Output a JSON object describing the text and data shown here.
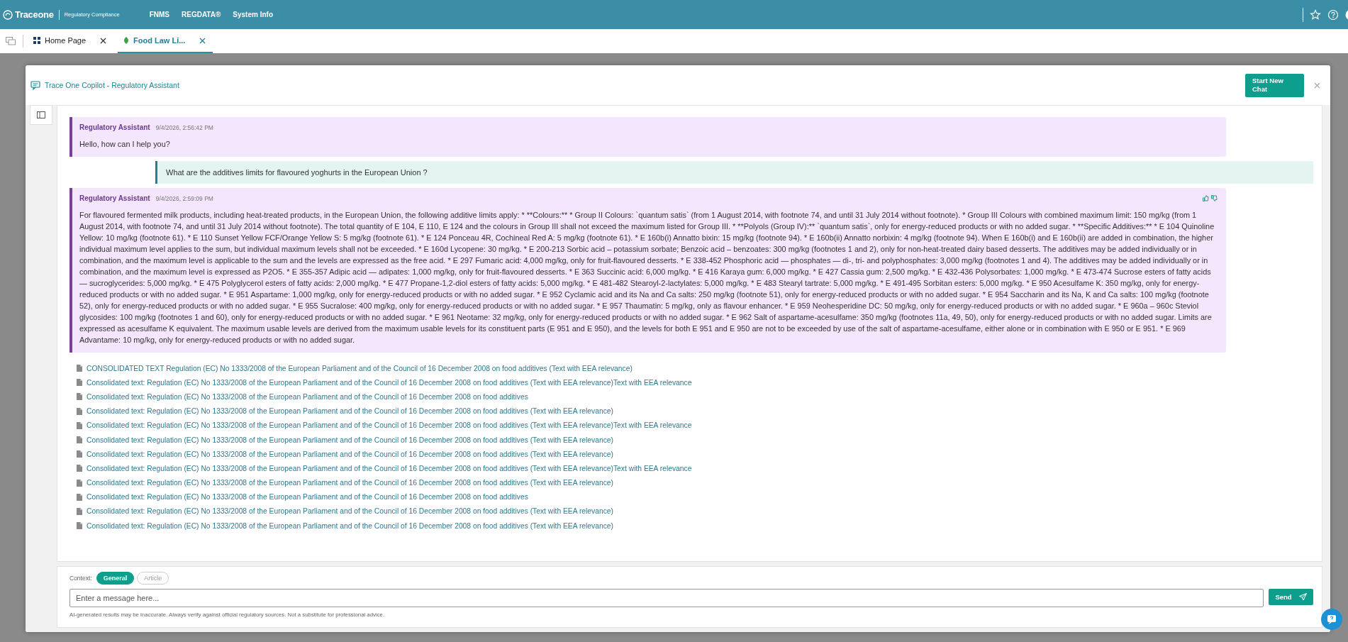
{
  "app": {
    "brand": "Traceone",
    "subtitle": "Regulatory Compliance",
    "nav": [
      {
        "label": "FNMS"
      },
      {
        "label": "REGDATA®"
      },
      {
        "label": "System Info"
      }
    ]
  },
  "tabs": [
    {
      "label": "Home Page",
      "selected": false
    },
    {
      "label": "Food Law Li...",
      "selected": true
    }
  ],
  "dialog": {
    "title": "Trace One Copilot - Regulatory Assistant",
    "new_chat_button": "Start New Chat"
  },
  "messages": [
    {
      "kind": "assistant",
      "author": "Regulatory Assistant",
      "time": "9/4/2026, 2:56:42 PM",
      "text": "Hello, how can I help you?",
      "feedback": false
    },
    {
      "kind": "user",
      "text": "What are the additives limits for flavoured yoghurts in the European Union ?"
    },
    {
      "kind": "assistant",
      "author": "Regulatory Assistant",
      "time": "9/4/2026, 2:59:09 PM",
      "feedback": true,
      "text": "For flavoured fermented milk products, including heat-treated products, in the European Union, the following additive limits apply: * **Colours:** * Group II Colours: `quantum satis` (from 1 August 2014, with footnote 74, and until 31 July 2014 without footnote). * Group III Colours with combined maximum limit: 150 mg/kg (from 1 August 2014, with footnote 74, and until 31 July 2014 without footnote). The total quantity of E 104, E 110, E 124 and the colours in Group III shall not exceed the maximum listed for Group III. * **Polyols (Group IV):** `quantum satis`, only for energy-reduced products or with no added sugar. * **Specific Additives:** * E 104 Quinoline Yellow: 10 mg/kg (footnote 61). * E 110 Sunset Yellow FCF/Orange Yellow S: 5 mg/kg (footnote 61). * E 124 Ponceau 4R, Cochineal Red A: 5 mg/kg (footnote 61). * E 160b(i) Annatto bixin: 15 mg/kg (footnote 94). * E 160b(ii) Annatto norbixin: 4 mg/kg (footnote 94). When E 160b(i) and E 160b(ii) are added in combination, the higher individual maximum level applies to the sum, but individual maximum levels shall not be exceeded. * E 160d Lycopene: 30 mg/kg. * E 200-213 Sorbic acid – potassium sorbate; Benzoic acid – benzoates: 300 mg/kg (footnotes 1 and 2), only for non-heat-treated dairy based desserts. The additives may be added individually or in combination, and the maximum level is applicable to the sum and the levels are expressed as the free acid. * E 297 Fumaric acid: 4,000 mg/kg, only for fruit-flavoured desserts. * E 338-452 Phosphoric acid — phosphates — di-, tri- and polyphosphates: 3,000 mg/kg (footnotes 1 and 4). The additives may be added individually or in combination, and the maximum level is expressed as P2O5. * E 355-357 Adipic acid — adipates: 1,000 mg/kg, only for fruit-flavoured desserts. * E 363 Succinic acid: 6,000 mg/kg. * E 416 Karaya gum: 6,000 mg/kg. * E 427 Cassia gum: 2,500 mg/kg. * E 432-436 Polysorbates: 1,000 mg/kg. * E 473-474 Sucrose esters of fatty acids — sucroglycerides: 5,000 mg/kg. * E 475 Polyglycerol esters of fatty acids: 2,000 mg/kg. * E 477 Propane-1,2-diol esters of fatty acids: 5,000 mg/kg. * E 481-482 Stearoyl-2-lactylates: 5,000 mg/kg. * E 483 Stearyl tartrate: 5,000 mg/kg. * E 491-495 Sorbitan esters: 5,000 mg/kg. * E 950 Acesulfame K: 350 mg/kg, only for energy-reduced products or with no added sugar. * E 951 Aspartame: 1,000 mg/kg, only for energy-reduced products or with no added sugar. * E 952 Cyclamic acid and its Na and Ca salts: 250 mg/kg (footnote 51), only for energy-reduced products or with no added sugar. * E 954 Saccharin and its Na, K and Ca salts: 100 mg/kg (footnote 52), only for energy-reduced products or with no added sugar. * E 955 Sucralose: 400 mg/kg, only for energy-reduced products or with no added sugar. * E 957 Thaumatin: 5 mg/kg, only as flavour enhancer. * E 959 Neohesperidine DC: 50 mg/kg, only for energy-reduced products or with no added sugar. * E 960a – 960c Steviol glycosides: 100 mg/kg (footnotes 1 and 60), only for energy-reduced products or with no added sugar. * E 961 Neotame: 32 mg/kg, only for energy-reduced products or with no added sugar. * E 962 Salt of aspartame-acesulfame: 350 mg/kg (footnotes 11a, 49, 50), only for energy-reduced products or with no added sugar. Limits are expressed as acesulfame K equivalent. The maximum usable levels are derived from the maximum usable levels for its constituent parts (E 951 and E 950), and the levels for both E 951 and E 950 are not to be exceeded by use of the salt of aspartame-acesulfame, either alone or in combination with E 950 or E 951. * E 969 Advantame: 10 mg/kg, only for energy-reduced products or with no added sugar."
    }
  ],
  "sources": [
    "CONSOLIDATED TEXT Regulation (EC) No 1333/2008 of the European Parliament and of the Council of 16 December 2008 on food additives (Text with EEA relevance)",
    "Consolidated text: Regulation (EC) No 1333/2008 of the European Parliament and of the Council of 16 December 2008 on food additives (Text with EEA relevance)Text with EEA relevance",
    "Consolidated text: Regulation (EC) No 1333/2008 of the European Parliament and of the Council of 16 December 2008 on food additives",
    "Consolidated text: Regulation (EC) No 1333/2008 of the European Parliament and of the Council of 16 December 2008 on food additives (Text with EEA relevance)",
    "Consolidated text: Regulation (EC) No 1333/2008 of the European Parliament and of the Council of 16 December 2008 on food additives (Text with EEA relevance)Text with EEA relevance",
    "Consolidated text: Regulation (EC) No 1333/2008 of the European Parliament and of the Council of 16 December 2008 on food additives (Text with EEA relevance)",
    "Consolidated text: Regulation (EC) No 1333/2008 of the European Parliament and of the Council of 16 December 2008 on food additives (Text with EEA relevance)",
    "Consolidated text: Regulation (EC) No 1333/2008 of the European Parliament and of the Council of 16 December 2008 on food additives (Text with EEA relevance)Text with EEA relevance",
    "Consolidated text: Regulation (EC) No 1333/2008 of the European Parliament and of the Council of 16 December 2008 on food additives (Text with EEA relevance)",
    "Consolidated text: Regulation (EC) No 1333/2008 of the European Parliament and of the Council of 16 December 2008 on food additives",
    "Consolidated text: Regulation (EC) No 1333/2008 of the European Parliament and of the Council of 16 December 2008 on food additives (Text with EEA relevance)",
    "Consolidated text: Regulation (EC) No 1333/2008 of the European Parliament and of the Council of 16 December 2008 on food additives (Text with EEA relevance)"
  ],
  "context": {
    "label": "Context:",
    "options": [
      {
        "label": "General",
        "selected": true
      },
      {
        "label": "Article",
        "selected": false
      }
    ]
  },
  "composer": {
    "placeholder": "Enter a message here...",
    "send_button": "Send"
  },
  "disclaimer": "AI-generated results may be inaccurate. Always verify against official regulatory sources. Not a substitute for professional advice."
}
